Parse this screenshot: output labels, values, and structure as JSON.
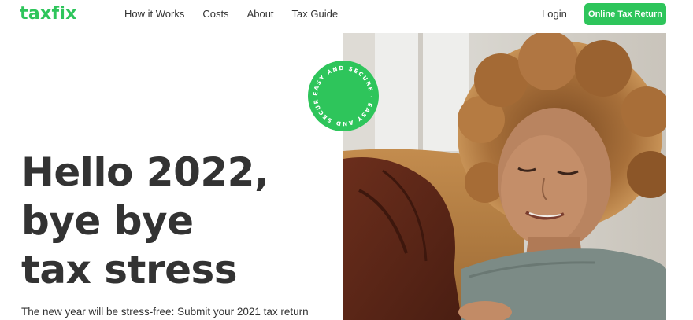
{
  "header": {
    "logo": "taxfix",
    "nav": [
      "How it Works",
      "Costs",
      "About",
      "Tax Guide"
    ],
    "login_label": "Login",
    "cta_label": "Online Tax Return"
  },
  "hero": {
    "headline_lines": [
      "Hello 2022,",
      "bye bye",
      "tax stress"
    ],
    "subtext": "The new year will be stress-free: Submit your 2021 tax return",
    "badge_text": "EASY AND SECURE · EASY AND SECURE ·",
    "image_icon": "woman-photo"
  },
  "colors": {
    "brand_green": "#2ec55b",
    "text_dark": "#333333"
  }
}
